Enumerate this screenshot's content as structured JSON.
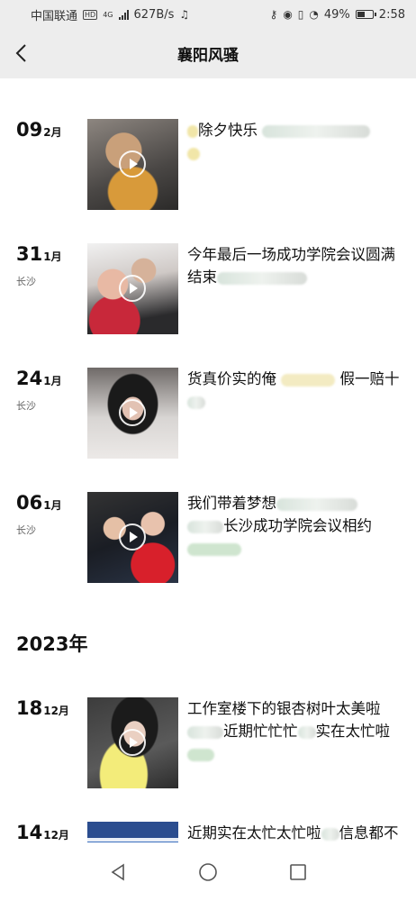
{
  "status": {
    "carrier": "中国联通",
    "hd": "HD",
    "network": "4G",
    "speed": "627B/s",
    "battery": "49%",
    "battery_level": 0.49,
    "time": "2:58"
  },
  "header": {
    "title": "襄阳风骚"
  },
  "posts": [
    {
      "day": "09",
      "month": "2月",
      "location": "",
      "text_a": "除夕快乐",
      "text_b": ""
    },
    {
      "day": "31",
      "month": "1月",
      "location": "长沙",
      "text_a": "今年最后一场成功学院会议圆满结束",
      "text_b": ""
    },
    {
      "day": "24",
      "month": "1月",
      "location": "长沙",
      "text_a": "货真价实的俺",
      "text_b": "假一赔十"
    },
    {
      "day": "06",
      "month": "1月",
      "location": "长沙",
      "text_a": "我们带着梦想",
      "text_b": "长沙成功学院会议相约"
    }
  ],
  "year_header": "2023年",
  "posts_2023": [
    {
      "day": "18",
      "month": "12月",
      "location": "",
      "text_a": "工作室楼下的银杏树叶太美啦",
      "text_b": "近期忙忙忙",
      "text_c": "实在太忙啦"
    },
    {
      "day": "14",
      "month": "12月",
      "location": "",
      "text_a": "近期实在太忙太忙啦",
      "text_b": "信息都不方便及时回复，抱歉啦"
    }
  ],
  "colors": {
    "bar_bg": "#ededed",
    "text": "#111111",
    "secondary": "#666666"
  }
}
